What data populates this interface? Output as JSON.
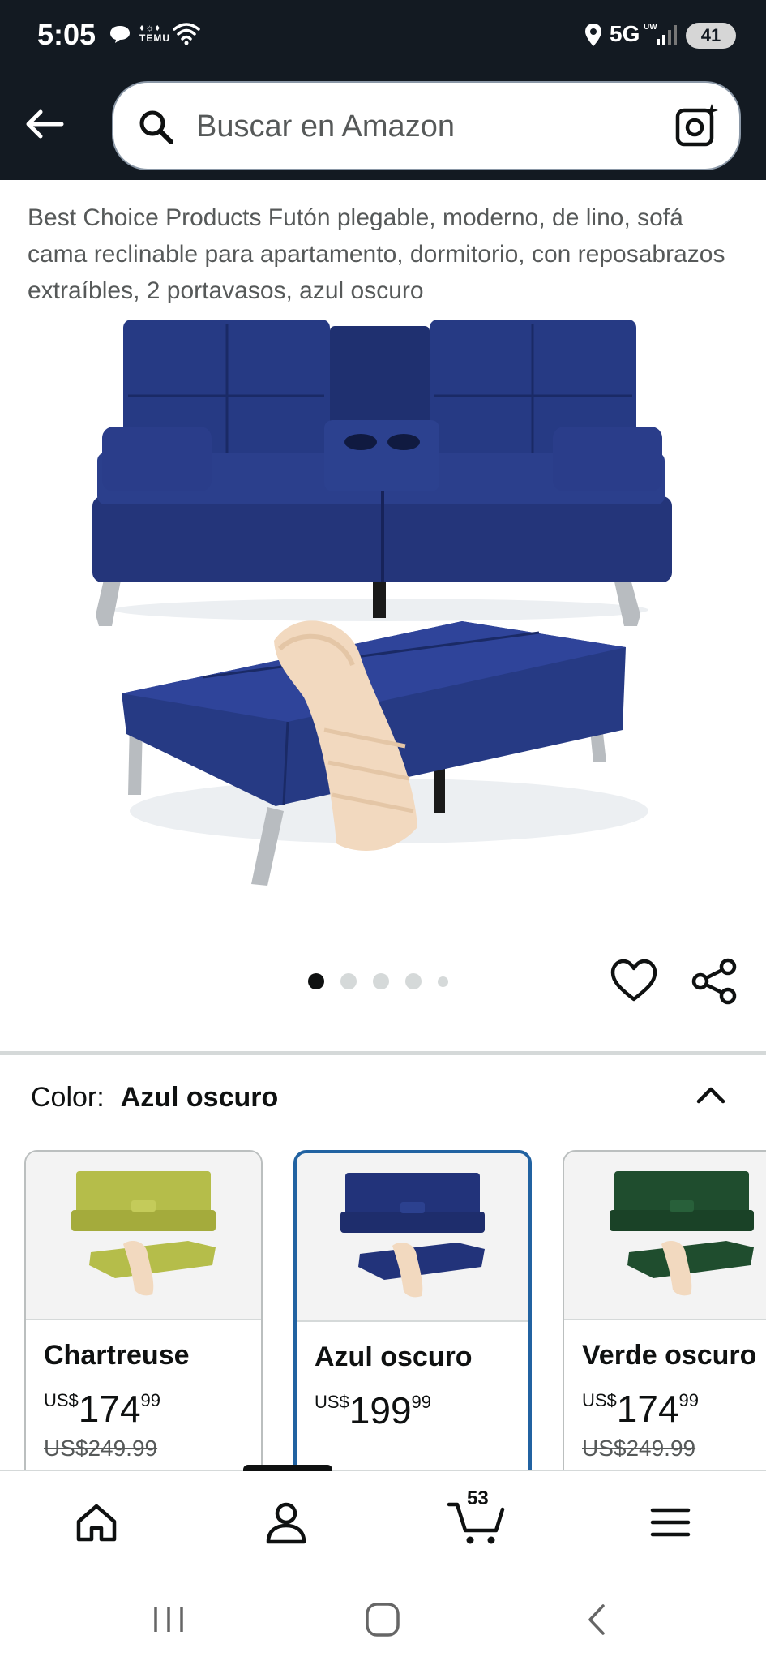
{
  "status_bar": {
    "time": "5:05",
    "temu_label": "TEMU",
    "network": "5G",
    "network_sub": "UW",
    "battery": "41"
  },
  "header": {
    "search_placeholder": "Buscar en Amazon"
  },
  "product": {
    "title": "Best Choice Products Futón plegable, moderno, de lino, sofá cama reclinable para apartamento, dormitorio, con reposabrazos extraíbles, 2 portavasos, azul oscuro",
    "image_count": 5,
    "active_image": 1
  },
  "color_selector": {
    "label": "Color:",
    "selected": "Azul oscuro",
    "options": [
      {
        "name": "Chartreuse",
        "currency": "US$",
        "price_whole": "174",
        "price_fraction": "99",
        "list_price": "US$249.99",
        "color": "#b5bd4a",
        "selected": false
      },
      {
        "name": "Azul oscuro",
        "currency": "US$",
        "price_whole": "199",
        "price_fraction": "99",
        "list_price": "",
        "color": "#22337a",
        "selected": true
      },
      {
        "name": "Verde oscuro",
        "currency": "US$",
        "price_whole": "174",
        "price_fraction": "99",
        "list_price": "US$249.99",
        "color": "#1f4d2e",
        "selected": false
      }
    ]
  },
  "bottom_nav": {
    "cart_count": "53",
    "items": [
      "home-icon",
      "account-icon",
      "cart-icon",
      "menu-icon"
    ]
  },
  "colors": {
    "header_bg": "#131a22",
    "accent_border": "#2162a1",
    "sofa_blue": "#22337a"
  }
}
